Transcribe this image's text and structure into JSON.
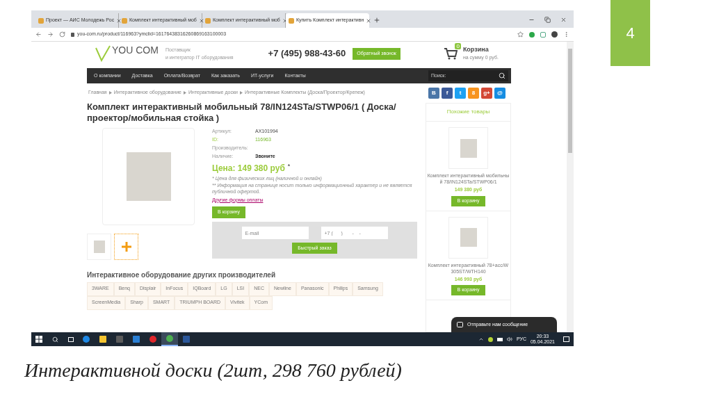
{
  "slide": {
    "number": "4",
    "caption": "Интерактивной доски (2шт, 298 760 рублей)"
  },
  "browser": {
    "tabs": [
      {
        "title": "Проект — АИС Молодежь Рос",
        "selected": false
      },
      {
        "title": "Комплект интерактивный моб",
        "selected": false
      },
      {
        "title": "Комплект интерактивный моб",
        "selected": false
      },
      {
        "title": "Купить Комплект интерактивн",
        "selected": true
      }
    ],
    "address": "you-com.ru/product/116963?ymclid=16176438316260869163100003"
  },
  "header": {
    "logo": "YOU COM",
    "tagline": [
      "Поставщик",
      "и интегратор IT оборудования"
    ],
    "phone": "+7 (495) 988-43-60",
    "callback_button": "Обратный звонок",
    "cart_count": "0",
    "cart_title": "Корзина",
    "cart_sum": "на сумму 0 руб."
  },
  "nav": {
    "items": [
      "О компании",
      "Доставка",
      "Оплата/Возврат",
      "Как заказать",
      "ИТ-услуги",
      "Контакты"
    ],
    "search_label": "Поиск:"
  },
  "breadcrumb": [
    "Главная",
    "Интерактивное оборудование",
    "Интерактивные доски",
    "Интерактивные Комплекты (Доска/Проектор/Крепеж)"
  ],
  "social": [
    {
      "label": "B",
      "color": "#4a76a8"
    },
    {
      "label": "f",
      "color": "#3b5998"
    },
    {
      "label": "t",
      "color": "#1da1f2"
    },
    {
      "label": "8",
      "color": "#f7931e"
    },
    {
      "label": "g+",
      "color": "#d34836"
    },
    {
      "label": "@",
      "color": "#168de2"
    }
  ],
  "product": {
    "title": "Комплект интерактивный мобильный 78/IN124STa/STWP06/1 ( Доска/ проектор/мобильная стойка )",
    "details": [
      {
        "label": "Артикул:",
        "value": "AX101994",
        "kind": "plain"
      },
      {
        "label": "ID:",
        "value": "116963",
        "kind": "accent"
      },
      {
        "label": "Производитель:",
        "kind": "plain"
      },
      {
        "label": "Наличие:",
        "value": "Звоните",
        "kind": "bold"
      }
    ],
    "price": "Цена: 149 380 руб",
    "price_mark": "*",
    "notes": [
      "* Цена для физических лиц (наличной и онлайн)",
      "** Информация на странице носит только информационный характер и не является публичной офертой."
    ],
    "payment_link": "Другие формы оплаты",
    "cart_button": "В корзину"
  },
  "quick_order": {
    "email_placeholder": "E-mail",
    "phone_placeholder": "+7 (___) ___-__-__",
    "button": "Быстрый заказ"
  },
  "brands": {
    "heading": "Интерактивное оборудование других производителей",
    "items": [
      "3WARE",
      "Benq",
      "Displair",
      "InFocus",
      "IQBoard",
      "LG",
      "LSI",
      "NEC",
      "Newline",
      "Panasonic",
      "Philips",
      "Samsung",
      "ScreenMedia",
      "Sharp",
      "SMART",
      "TRIUMPH BOARD",
      "Vivitek",
      "YCom"
    ]
  },
  "sidebar": {
    "title": "Похожие товары",
    "items": [
      {
        "name": "Комплект интерактивный мобильный 78/IN124STa/STWP06/1",
        "price": "149 380 руб",
        "button": "В корзину"
      },
      {
        "name": "Комплект интерактивный 78+acc/W305ST/WTH140",
        "price": "146 993 руб",
        "button": "В корзину"
      }
    ]
  },
  "chat": "Отправьте нам сообщение",
  "taskbar": {
    "apps": [
      {
        "kind": "edge",
        "selected": false
      },
      {
        "kind": "folder",
        "selected": false
      },
      {
        "kind": "store",
        "selected": false
      },
      {
        "kind": "mail",
        "selected": false
      },
      {
        "kind": "opera",
        "selected": false
      },
      {
        "kind": "chrome",
        "selected": true
      },
      {
        "kind": "word",
        "selected": false
      }
    ],
    "language": "РУС",
    "time": "20:33",
    "date": "05.04.2021"
  }
}
